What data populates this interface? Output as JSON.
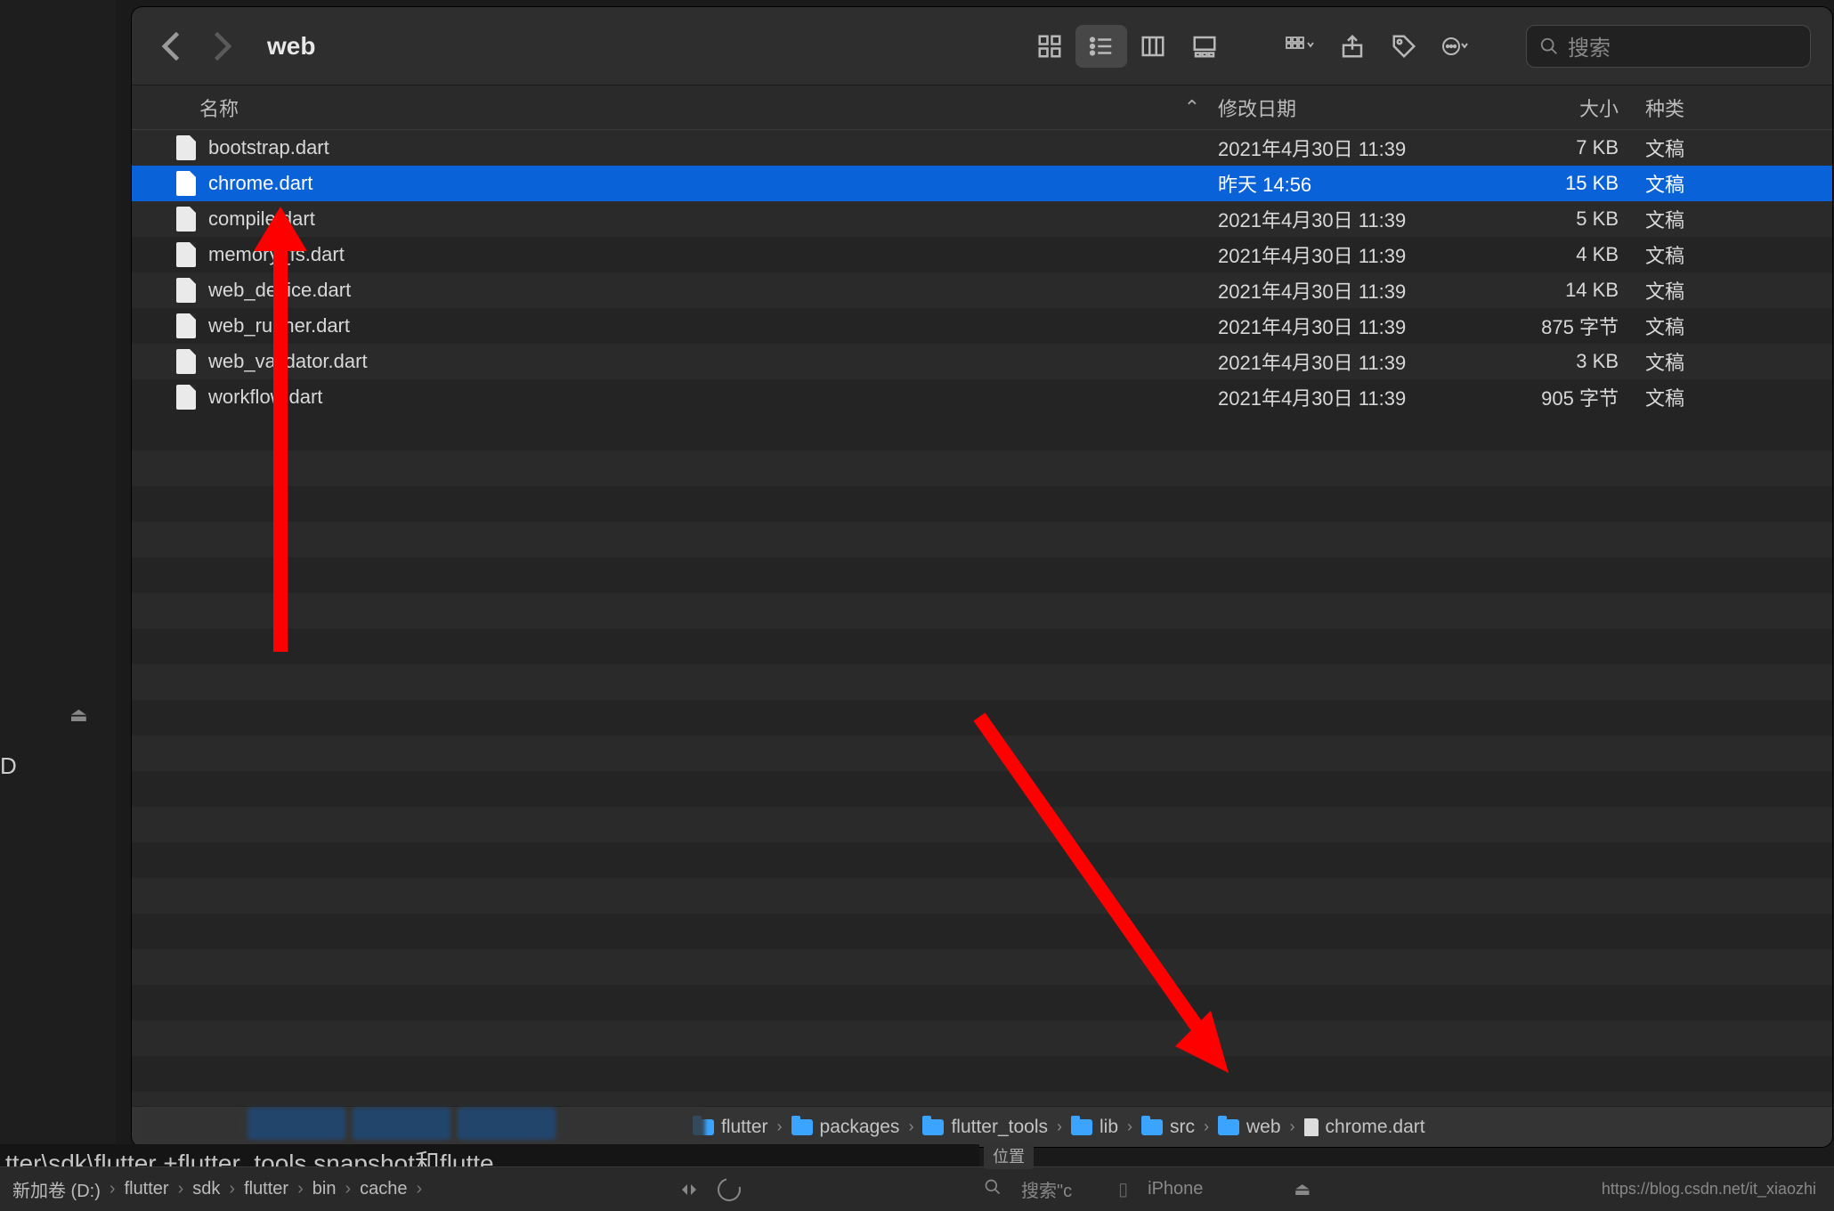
{
  "window": {
    "title": "web"
  },
  "search": {
    "placeholder": "搜索"
  },
  "columns": {
    "name": "名称",
    "sort_arrow": "⌃",
    "date": "修改日期",
    "size": "大小",
    "kind": "种类"
  },
  "files": [
    {
      "name": "bootstrap.dart",
      "date": "2021年4月30日 11:39",
      "size": "7 KB",
      "kind": "文稿",
      "selected": false
    },
    {
      "name": "chrome.dart",
      "date": "昨天 14:56",
      "size": "15 KB",
      "kind": "文稿",
      "selected": true
    },
    {
      "name": "compile.dart",
      "date": "2021年4月30日 11:39",
      "size": "5 KB",
      "kind": "文稿",
      "selected": false
    },
    {
      "name": "memory_fs.dart",
      "date": "2021年4月30日 11:39",
      "size": "4 KB",
      "kind": "文稿",
      "selected": false
    },
    {
      "name": "web_device.dart",
      "date": "2021年4月30日 11:39",
      "size": "14 KB",
      "kind": "文稿",
      "selected": false
    },
    {
      "name": "web_runner.dart",
      "date": "2021年4月30日 11:39",
      "size": "875 字节",
      "kind": "文稿",
      "selected": false
    },
    {
      "name": "web_validator.dart",
      "date": "2021年4月30日 11:39",
      "size": "3 KB",
      "kind": "文稿",
      "selected": false
    },
    {
      "name": "workflow.dart",
      "date": "2021年4月30日 11:39",
      "size": "905 字节",
      "kind": "文稿",
      "selected": false
    }
  ],
  "pathbar": [
    "flutter",
    "packages",
    "flutter_tools",
    "lib",
    "src",
    "web"
  ],
  "pathbar_file": "chrome.dart",
  "osbar": {
    "crumbs": [
      "新加卷 (D:)",
      "flutter",
      "sdk",
      "flutter",
      "bin",
      "cache"
    ],
    "search_placeholder": "搜索\"c",
    "device": "iPhone",
    "overlay_text": "位置",
    "watermark": "https://blog.csdn.net/it_xiaozhi"
  },
  "trunc_line": "tter\\sdk\\flutter                                     +flutter_tools.snapshot和flutte",
  "left": {
    "eject": "⏏",
    "letter": "D"
  }
}
